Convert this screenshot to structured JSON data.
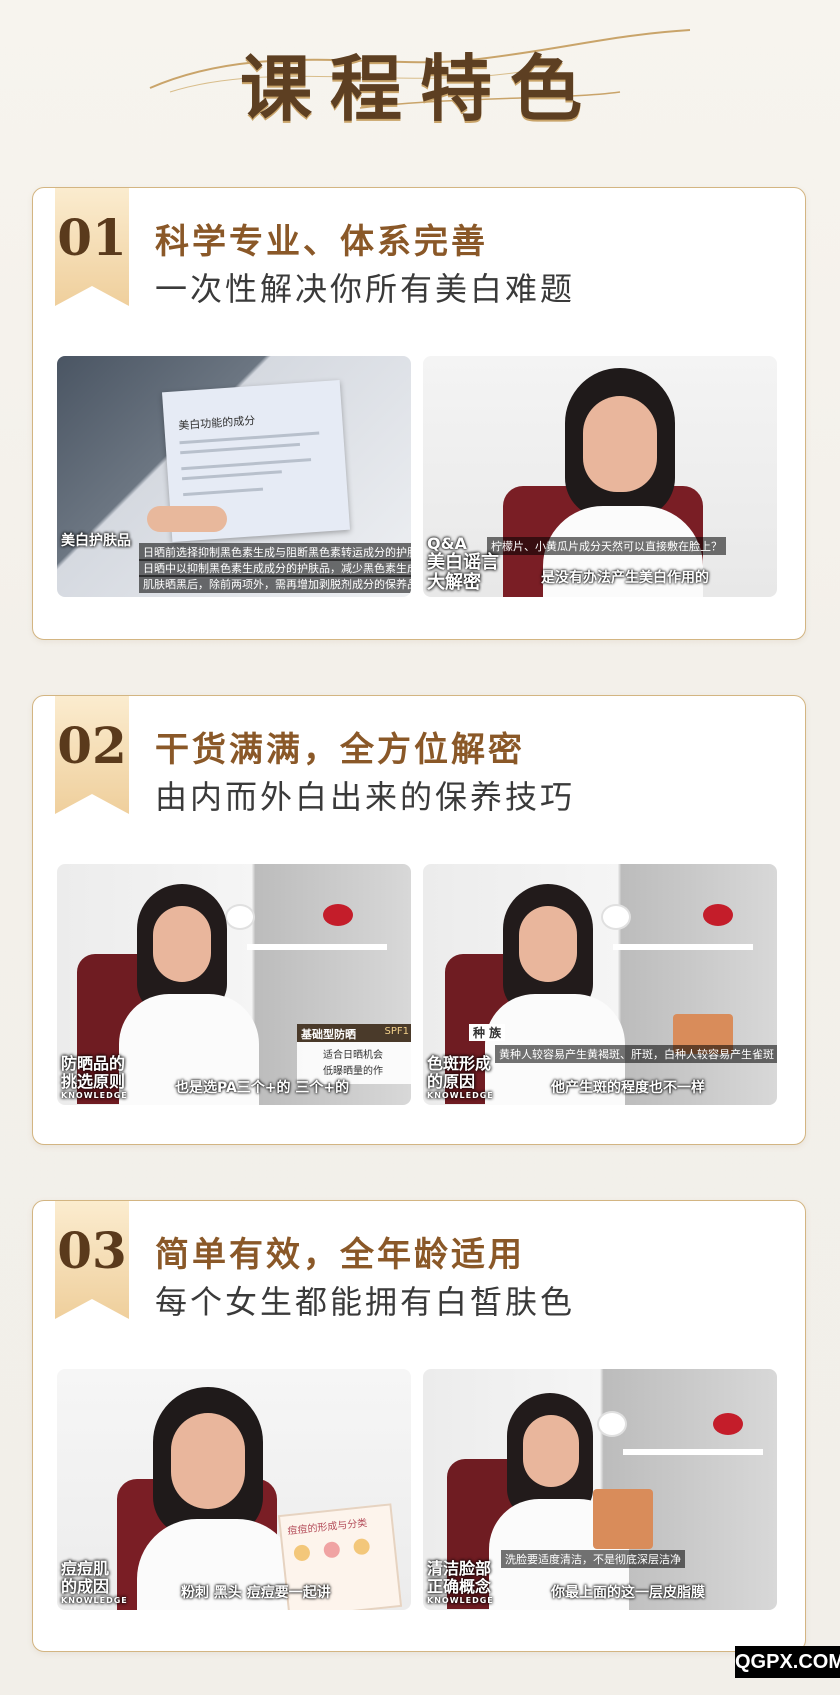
{
  "header": {
    "title": "课程特色"
  },
  "cards": [
    {
      "number": "01",
      "heading": "科学专业、体系完善",
      "subheading": "一次性解决你所有美白难题",
      "left": {
        "doc_title": "美白功能的成分",
        "tag": "美白护肤品",
        "line1": "日晒前选择抑制黑色素生成与阻断黑色素转运成分的护肤品",
        "line2": "日晒中以抑制黑色素生成成分的护肤品，减少黑色素生成",
        "line3": "肌肤晒黑后，除前两项外，需再增加剥脱剂成分的保养品加强代谢"
      },
      "right": {
        "qa": "Q&A",
        "tag_line1": "美白谣言",
        "tag_line2": "大解密",
        "top": "柠檬片、小黄瓜片成分天然可以直接敷在脸上？",
        "caption": "是没有办法产生美白作用的"
      }
    },
    {
      "number": "02",
      "heading": "干货满满，全方位解密",
      "subheading": "由内而外白出来的保养技巧",
      "left": {
        "tag_line1": "防晒品的",
        "tag_line2": "挑选原则",
        "knowledge": "KNOWLEDGE",
        "box_title": "基础型防晒",
        "box_spf": "SPF1",
        "box_line1": "适合日晒机会",
        "box_line2": "低曝晒量的作",
        "caption": "也是选PA三个+的 三个+的"
      },
      "right": {
        "tag_line1": "色斑形成",
        "tag_line2": "的原因",
        "knowledge": "KNOWLEDGE",
        "label": "种 族",
        "bar": "黄种人较容易产生黄褐斑、肝斑，白种人较容易产生雀斑",
        "caption": "他产生斑的程度也不一样"
      }
    },
    {
      "number": "03",
      "heading": "简单有效，全年龄适用",
      "subheading": "每个女生都能拥有白皙肤色",
      "left": {
        "tag_line1": "痘痘肌",
        "tag_line2": "的成因",
        "knowledge": "KNOWLEDGE",
        "board": "痘痘的形成与分类",
        "caption": "粉刺 黑头 痘痘要一起讲"
      },
      "right": {
        "tag_line1": "清洁脸部",
        "tag_line2": "正确概念",
        "knowledge": "KNOWLEDGE",
        "bar": "洗脸要适度清洁，不是彻底深层洁净",
        "caption": "你最上面的这一层皮脂膜"
      }
    }
  ],
  "watermark": "QGPX.COM",
  "colors": {
    "gold": "#d3b582",
    "heading": "#8a5828",
    "badge_top": "#fbe9c7",
    "badge_bottom": "#ecc994"
  }
}
